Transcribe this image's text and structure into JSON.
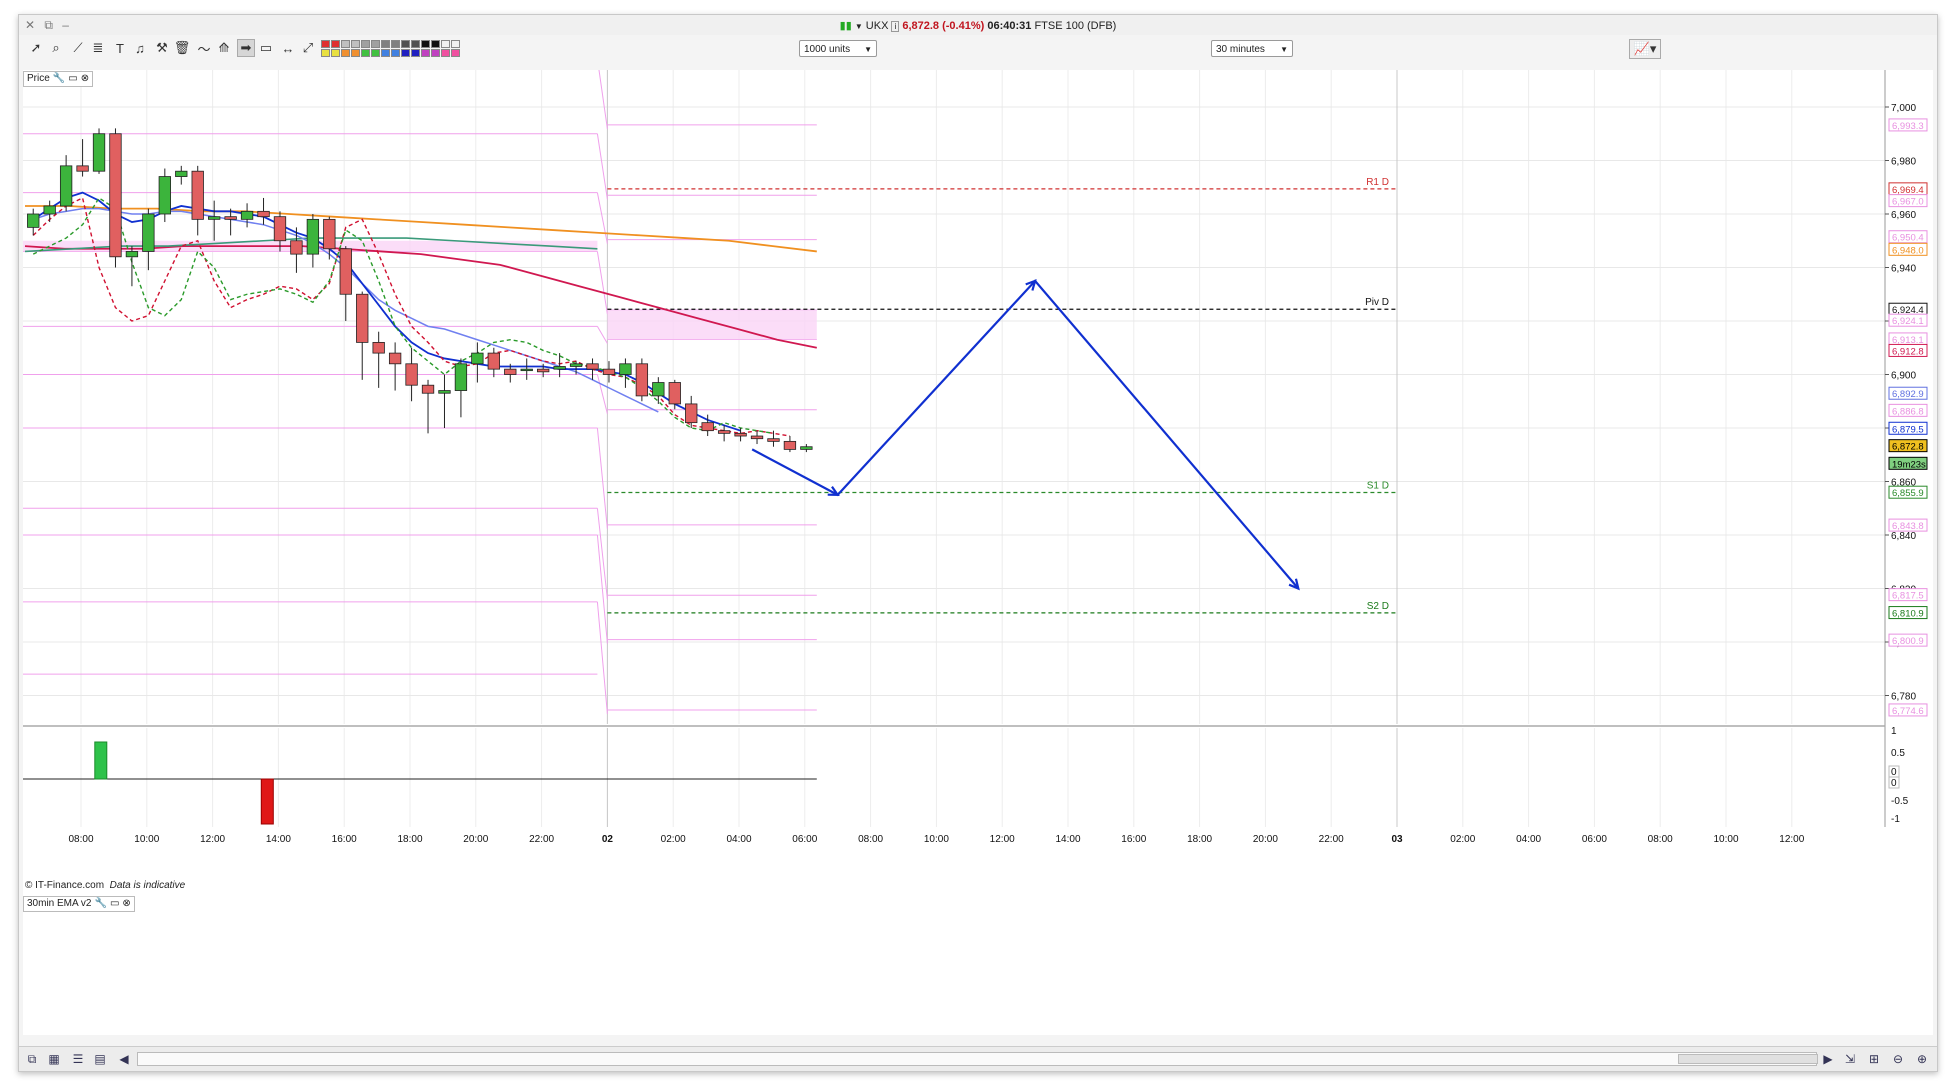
{
  "window": {
    "symbol": "UKX",
    "price_change": "6,872.8 (-0.41%)",
    "time": "06:40:31",
    "instrument": "FTSE 100 (DFB)"
  },
  "toolbar": {
    "units": "1000 units",
    "interval": "30 minutes",
    "swatch_colors": [
      "#e03030",
      "#c0c0c0",
      "#a0a0a0",
      "#808080",
      "#505050",
      "#101010",
      "#f0f0f0",
      "#e8e040",
      "#f09030",
      "#40c040",
      "#4080e0",
      "#2020c0",
      "#c040c0",
      "#f050a0"
    ]
  },
  "price_panel": {
    "label": "Price",
    "footer": "© IT-Finance.com",
    "footer_note": "Data is indicative"
  },
  "indicator_panel": {
    "label": "30min EMA v2",
    "axis_ticks": [
      "1",
      "0.5",
      "0",
      "0",
      "-0.5",
      "-1"
    ]
  },
  "chart_data": {
    "type": "candlestick",
    "y_axis_ticks": [
      7000,
      6980,
      6960,
      6940,
      6920,
      6900,
      6880,
      6860,
      6840,
      6820,
      6800,
      6780
    ],
    "y_axis_tick_labels": [
      "7,000",
      "6,980",
      "6,960",
      "6,940",
      "6,920",
      "6,900",
      "6,880",
      "6,860",
      "6,840",
      "6,820",
      "6,800",
      "6,780"
    ],
    "ylim": [
      6770,
      7012
    ],
    "x_axis_labels": [
      "08:00",
      "10:00",
      "12:00",
      "14:00",
      "16:00",
      "18:00",
      "20:00",
      "22:00",
      "02",
      "02:00",
      "04:00",
      "06:00",
      "08:00",
      "10:00",
      "12:00",
      "14:00",
      "16:00",
      "18:00",
      "20:00",
      "22:00",
      "03",
      "02:00",
      "04:00",
      "06:00",
      "08:00",
      "10:00",
      "12:00"
    ],
    "pivot_lines": [
      {
        "name": "R1 D",
        "value": 6969.4,
        "color": "#d03030"
      },
      {
        "name": "Piv D",
        "value": 6924.4,
        "color": "#111111"
      },
      {
        "name": "S1 D",
        "value": 6855.9,
        "color": "#2a8a2a"
      },
      {
        "name": "S2 D",
        "value": 6810.9,
        "color": "#1a7a1a"
      }
    ],
    "price_tags": [
      {
        "label": "6,993.3",
        "value": 6993.3,
        "color": "#e890e0",
        "fill": "#fff"
      },
      {
        "label": "6,969.4",
        "value": 6969.4,
        "color": "#d03030",
        "fill": "#fff"
      },
      {
        "label": "6,967.0",
        "value": 6965.0,
        "color": "#e890e0",
        "fill": "#fff"
      },
      {
        "label": "6,950.4",
        "value": 6951.5,
        "color": "#e890e0",
        "fill": "#fff"
      },
      {
        "label": "6,948.0",
        "value": 6946.8,
        "color": "#f09020",
        "fill": "#fff"
      },
      {
        "label": "6,924.4",
        "value": 6924.4,
        "color": "#111111",
        "fill": "#fff"
      },
      {
        "label": "6,924.1",
        "value": 6920.3,
        "color": "#e890e0",
        "fill": "#fff"
      },
      {
        "label": "6,913.1",
        "value": 6913.3,
        "color": "#e890e0",
        "fill": "#fff"
      },
      {
        "label": "6,912.8",
        "value": 6909.0,
        "color": "#d01850",
        "fill": "#fff"
      },
      {
        "label": "6,892.9",
        "value": 6893.0,
        "color": "#6070e0",
        "fill": "#fff"
      },
      {
        "label": "6,886.8",
        "value": 6886.6,
        "color": "#e890e0",
        "fill": "#fff"
      },
      {
        "label": "6,879.5",
        "value": 6879.9,
        "color": "#1030d0",
        "fill": "#fff"
      },
      {
        "label": "6,872.8",
        "value": 6873.4,
        "color": "#000000",
        "fill": "#f0c020"
      },
      {
        "label": "19m23s",
        "value": 6866.8,
        "color": "#000000",
        "fill": "#80d080"
      },
      {
        "label": "6,855.9",
        "value": 6856.0,
        "color": "#2a8a2a",
        "fill": "#fff"
      },
      {
        "label": "6,843.8",
        "value": 6843.7,
        "color": "#e890e0",
        "fill": "#fff"
      },
      {
        "label": "6,817.5",
        "value": 6817.7,
        "color": "#e890e0",
        "fill": "#fff"
      },
      {
        "label": "6,810.9",
        "value": 6811.0,
        "color": "#1a7a1a",
        "fill": "#fff"
      },
      {
        "label": "6,800.9",
        "value": 6800.7,
        "color": "#e890e0",
        "fill": "#fff"
      },
      {
        "label": "6,774.6",
        "value": 6774.6,
        "color": "#e890e0",
        "fill": "#fff"
      }
    ],
    "candles": [
      [
        6955,
        6962,
        6952,
        6960
      ],
      [
        6960,
        6965,
        6957,
        6963
      ],
      [
        6963,
        6982,
        6961,
        6978
      ],
      [
        6978,
        6988,
        6974,
        6976
      ],
      [
        6976,
        6992,
        6975,
        6990
      ],
      [
        6990,
        6992,
        6940,
        6944
      ],
      [
        6944,
        6948,
        6933,
        6946
      ],
      [
        6946,
        6962,
        6939,
        6960
      ],
      [
        6960,
        6977,
        6957,
        6974
      ],
      [
        6974,
        6978,
        6971,
        6976
      ],
      [
        6976,
        6978,
        6952,
        6958
      ],
      [
        6958,
        6965,
        6950,
        6959
      ],
      [
        6959,
        6962,
        6952,
        6958
      ],
      [
        6958,
        6964,
        6955,
        6961
      ],
      [
        6961,
        6966,
        6956,
        6959
      ],
      [
        6959,
        6961,
        6946,
        6950
      ],
      [
        6950,
        6955,
        6938,
        6945
      ],
      [
        6945,
        6960,
        6940,
        6958
      ],
      [
        6958,
        6959,
        6943,
        6947
      ],
      [
        6947,
        6948,
        6920,
        6930
      ],
      [
        6930,
        6931,
        6898,
        6912
      ],
      [
        6912,
        6916,
        6895,
        6908
      ],
      [
        6908,
        6912,
        6894,
        6904
      ],
      [
        6904,
        6910,
        6890,
        6896
      ],
      [
        6896,
        6898,
        6878,
        6893
      ],
      [
        6893,
        6900,
        6880,
        6894
      ],
      [
        6894,
        6906,
        6884,
        6904
      ],
      [
        6904,
        6912,
        6897,
        6908
      ],
      [
        6908,
        6910,
        6899,
        6902
      ],
      [
        6902,
        6904,
        6897,
        6900
      ],
      [
        6902,
        6906,
        6898,
        6902
      ],
      [
        6902,
        6904,
        6899,
        6901
      ],
      [
        6902,
        6908,
        6899,
        6903
      ],
      [
        6903,
        6905,
        6900,
        6904
      ],
      [
        6904,
        6906,
        6898,
        6902
      ],
      [
        6902,
        6905,
        6897,
        6900
      ],
      [
        6900,
        6906,
        6895,
        6904
      ],
      [
        6904,
        6906,
        6890,
        6892
      ],
      [
        6892,
        6899,
        6889,
        6897
      ],
      [
        6897,
        6898,
        6887,
        6889
      ],
      [
        6889,
        6892,
        6880,
        6882
      ],
      [
        6882,
        6885,
        6877,
        6879
      ],
      [
        6879,
        6881,
        6875,
        6878
      ],
      [
        6878,
        6880,
        6875,
        6877
      ],
      [
        6877,
        6879,
        6874,
        6876
      ],
      [
        6876,
        6879,
        6873,
        6875
      ],
      [
        6875,
        6877,
        6871,
        6872
      ],
      [
        6872,
        6874,
        6871,
        6873
      ]
    ],
    "ema_blue": [
      6958,
      6962,
      6966,
      6968,
      6965,
      6960,
      6957,
      6958,
      6961,
      6963,
      6962,
      6961,
      6961,
      6960,
      6959,
      6956,
      6953,
      6951,
      6947,
      6942,
      6934,
      6926,
      6918,
      6912,
      6908,
      6906,
      6905,
      6904,
      6903,
      6903,
      6903,
      6903,
      6902,
      6902,
      6902,
      6901,
      6900,
      6897,
      6893,
      6889,
      6886,
      6883,
      6881,
      6879
    ],
    "ema_lightblue": [
      6958,
      6960,
      6961,
      6962,
      6962,
      6961,
      6960,
      6960,
      6961,
      6961,
      6960,
      6959,
      6958,
      6957,
      6956,
      6954,
      6952,
      6949,
      6945,
      6940,
      6934,
      6928,
      6924,
      6921,
      6918,
      6917,
      6915,
      6913,
      6911,
      6909,
      6907,
      6905,
      6903,
      6901,
      6898,
      6895,
      6892,
      6889,
      6886
    ],
    "ema_orange": [
      6963,
      6963,
      6962,
      6962,
      6961,
      6961,
      6960,
      6959,
      6958,
      6957,
      6956,
      6955,
      6954,
      6953,
      6952,
      6951,
      6950,
      6948,
      6946
    ],
    "ema_crimson": [
      6948,
      6947,
      6947,
      6947,
      6948,
      6948,
      6948,
      6948,
      6947,
      6946,
      6945,
      6943,
      6941,
      6937,
      6933,
      6929,
      6925,
      6921,
      6917,
      6913,
      6910
    ]
  }
}
